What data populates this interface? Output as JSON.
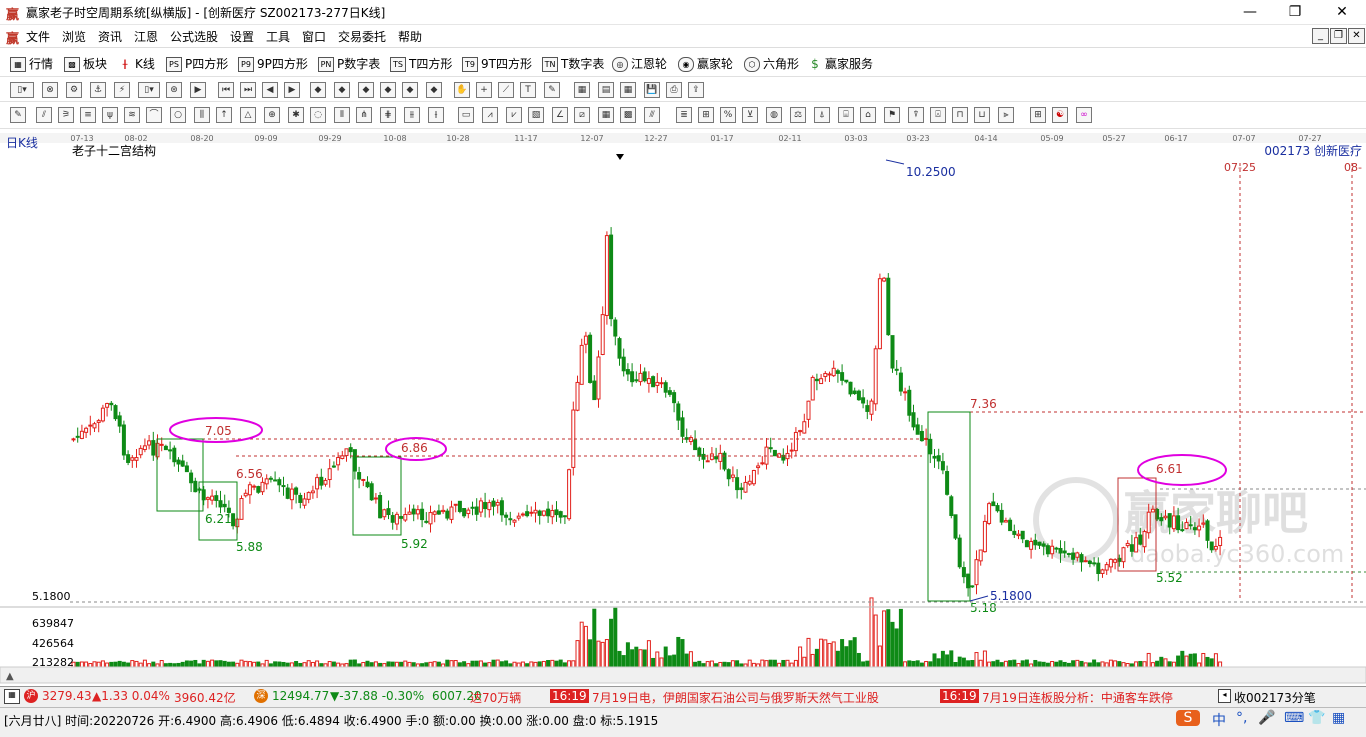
{
  "window": {
    "title": "赢家老子时空周期系统[纵横版] - [创新医疗  SZ002173-277日K线]",
    "min": "—",
    "max": "❐",
    "close": "✕"
  },
  "menu": [
    "文件",
    "浏览",
    "资讯",
    "江恩",
    "公式选股",
    "设置",
    "工具",
    "窗口",
    "交易委托",
    "帮助"
  ],
  "toolbar1": [
    "行情",
    "板块",
    "K线",
    "P四方形",
    "9P四方形",
    "P数字表",
    "T四方形",
    "9T四方形",
    "T数字表",
    "江恩轮",
    "赢家轮",
    "六角形",
    "赢家服务"
  ],
  "chart": {
    "period": "日K线",
    "indicator": "老子十二宫结构",
    "stock": "002173 创新医疗",
    "date_ticks": [
      "07-13",
      "08-02",
      "08-20",
      "09-09",
      "09-29",
      "10-08",
      "10-28",
      "11-17",
      "12-07",
      "12-27",
      "01-17",
      "02-11",
      "03-03",
      "03-23",
      "04-14",
      "05-09",
      "05-27",
      "06-17",
      "07-07",
      "07-27",
      "08-16"
    ],
    "future_marks": [
      "07-25",
      "08-"
    ],
    "annotations": {
      "high": "10.2500",
      "low": "5.1800",
      "low_axis": "5.1800",
      "box1_top": "7.05",
      "box1_mid": "6.56",
      "box1_low": "6.21",
      "box1_bottom": "5.88",
      "box2_top": "6.86",
      "box2_bottom": "5.92",
      "box3_top": "7.36",
      "box3_bottom": "5.18",
      "box4_top": "6.61",
      "box4_bottom": "5.52"
    },
    "volume_ticks": [
      "639847",
      "426564",
      "213282"
    ],
    "watermark": "赢家聊吧",
    "watermark_url": "daoba.yc360.com",
    "colors": {
      "up": "#e2211c",
      "down": "#0e8a16",
      "magenta": "#e000e0",
      "blue": "#1a2fa0"
    }
  },
  "statusbar": {
    "sh_index": "3279.43",
    "sh_change": "▲1.33 0.04%",
    "sh_amount": "3960.42亿",
    "sz_index": "12494.77",
    "sz_change": "▼-37.88 -0.30%",
    "sz_amount": "6007.20",
    "news1_prefix": "达70万辆",
    "news_time1": "16:19",
    "news1": "7月19日电，伊朗国家石油公司与俄罗斯天然气工业股",
    "news_time2": "16:19",
    "news2": "7月19日连板股分析：中通客车跌停",
    "right": "收002173分笔"
  },
  "info": "[六月廿八] 时间:20220726 开:6.4900 高:6.4906 低:6.4894 收:6.4900 手:0 额:0.00 换:0.00 涨:0.00 盘:0 标:5.1915",
  "tray": [
    "中",
    "°,",
    "🎤",
    "⌨",
    "👕",
    "▦"
  ]
}
